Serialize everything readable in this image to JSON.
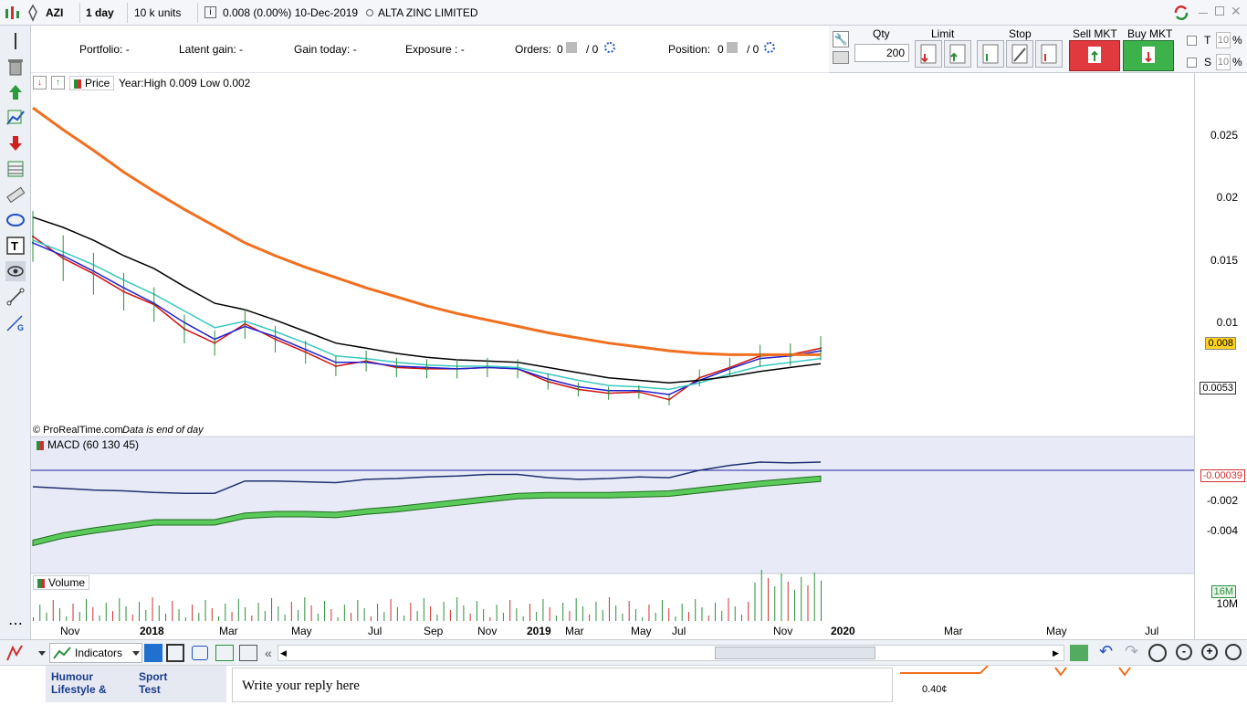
{
  "toolbar": {
    "symbol": "AZI",
    "period": "1 day",
    "units": "10 k units",
    "last": "0.008 (0.00%) 10-Dec-2019",
    "name": "ALTA ZINC LIMITED"
  },
  "account": {
    "portfolio": "Portfolio: -",
    "latent_gain": "Latent gain: -",
    "gain_today": "Gain today: -",
    "exposure": "Exposure : -",
    "orders_label": "Orders:",
    "orders_a": "0",
    "orders_sep": "/ 0",
    "position_label": "Position:",
    "position_a": "0",
    "position_sep": "/ 0"
  },
  "trade": {
    "qty_label": "Qty",
    "qty_value": "200",
    "limit_label": "Limit",
    "stop_label": "Stop",
    "sell_label": "Sell MKT",
    "buy_label": "Buy MKT",
    "t_label": "T",
    "t_value": "10",
    "s_label": "S",
    "s_value": "10",
    "pct": "%",
    "sell_color": "#e0393e",
    "buy_color": "#3db24a"
  },
  "chart_header": {
    "price_label": "Price",
    "range_text": "Year:High 0.009 Low 0.002",
    "source": "© ProRealTime.com",
    "source_note": "Data is end of day"
  },
  "panels": {
    "macd_label": "MACD (60 130 45)",
    "volume_label": "Volume"
  },
  "axis": {
    "price_ticks": [
      "0.025",
      "0.02",
      "0.015",
      "0.01"
    ],
    "price_tag_last": "0.008",
    "price_tag_ma": "0.0053",
    "macd_ticks": [
      "-0.002",
      "-0.004"
    ],
    "macd_tag": "-0.00039",
    "volume_ticks": [
      "10M"
    ],
    "volume_tag": "16M",
    "x_labels": [
      "Nov",
      "2018",
      "Mar",
      "May",
      "Jul",
      "Sep",
      "Nov",
      "2019",
      "Mar",
      "May",
      "Jul",
      "Nov",
      "2020",
      "Mar",
      "May",
      "Jul"
    ]
  },
  "bottom": {
    "indicators": "Indicators"
  },
  "forum": {
    "col1": [
      "Humour",
      "Lifestyle &"
    ],
    "col2": [
      "Sport",
      "Test"
    ],
    "reply_placeholder": "Write your reply here",
    "mini_value": "0.40¢"
  },
  "chart_data": {
    "type": "line",
    "x": [
      "2017-10",
      "2017-11",
      "2017-12",
      "2018-01",
      "2018-02",
      "2018-03",
      "2018-04",
      "2018-05",
      "2018-06",
      "2018-07",
      "2018-08",
      "2018-09",
      "2018-10",
      "2018-11",
      "2018-12",
      "2019-01",
      "2019-02",
      "2019-03",
      "2019-04",
      "2019-05",
      "2019-06",
      "2019-07",
      "2019-08",
      "2019-09",
      "2019-10",
      "2019-11",
      "2019-12"
    ],
    "series": [
      {
        "values": [
          0.0165,
          0.0148,
          0.0136,
          0.0122,
          0.0112,
          0.0093,
          0.0082,
          0.0097,
          0.0085,
          0.0075,
          0.0064,
          0.0068,
          0.0063,
          0.0062,
          0.0062,
          0.0063,
          0.0062,
          0.0052,
          0.0046,
          0.0043,
          0.0044,
          0.0038,
          0.0055,
          0.0063,
          0.0072,
          0.0073,
          0.0078
        ],
        "color": "#d01010"
      },
      {
        "values": [
          0.016,
          0.015,
          0.0138,
          0.0125,
          0.0113,
          0.0098,
          0.0085,
          0.0095,
          0.0087,
          0.0077,
          0.0067,
          0.0067,
          0.0064,
          0.0063,
          0.0062,
          0.0063,
          0.0062,
          0.0054,
          0.0048,
          0.0045,
          0.0045,
          0.0042,
          0.0053,
          0.0062,
          0.007,
          0.0072,
          0.0076
        ],
        "color": "#2020d0"
      },
      {
        "values": [
          0.0162,
          0.0153,
          0.0143,
          0.0131,
          0.012,
          0.0107,
          0.0094,
          0.0099,
          0.0091,
          0.0082,
          0.0072,
          0.007,
          0.0067,
          0.0065,
          0.0064,
          0.0064,
          0.0063,
          0.0058,
          0.0053,
          0.0049,
          0.0048,
          0.0046,
          0.0051,
          0.0058,
          0.0064,
          0.0067,
          0.007
        ],
        "color": "#38c8c0"
      },
      {
        "values": [
          0.018,
          0.0172,
          0.0162,
          0.015,
          0.014,
          0.0126,
          0.0113,
          0.0108,
          0.01,
          0.0091,
          0.0082,
          0.0078,
          0.0074,
          0.0071,
          0.0069,
          0.0068,
          0.0067,
          0.0063,
          0.0059,
          0.0055,
          0.0053,
          0.0051,
          0.0053,
          0.0056,
          0.006,
          0.0063,
          0.0066
        ],
        "color": "#000000"
      },
      {
        "values": [
          0.0265,
          0.0248,
          0.0232,
          0.0215,
          0.02,
          0.0186,
          0.0173,
          0.016,
          0.015,
          0.0141,
          0.0133,
          0.0125,
          0.0118,
          0.0111,
          0.0105,
          0.01,
          0.0095,
          0.009,
          0.0086,
          0.0082,
          0.0079,
          0.0076,
          0.0074,
          0.0073,
          0.0073,
          0.0073,
          0.0073
        ],
        "color": "#f07020"
      }
    ],
    "ylim": [
      0.0015,
      0.0285
    ],
    "grid": false
  }
}
